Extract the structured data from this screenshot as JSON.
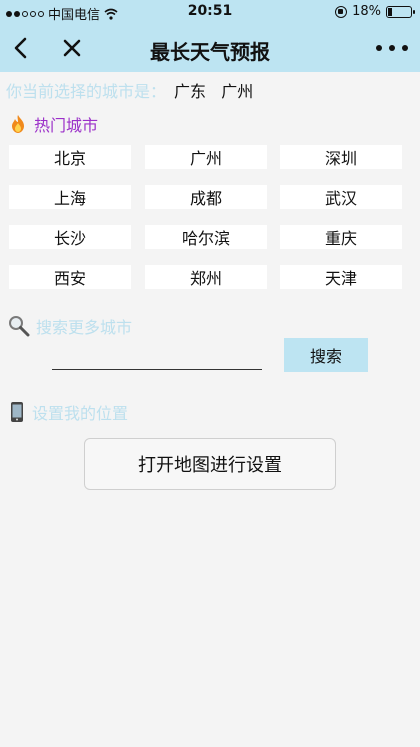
{
  "status_bar": {
    "carrier": "中国电信",
    "time": "20:51",
    "battery": "18%",
    "battery_level": 0.18
  },
  "nav": {
    "title": "最长天气预报"
  },
  "selection": {
    "label": "你当前选择的城市是：",
    "value": "广东   广州"
  },
  "hot_cities": {
    "title": "热门城市",
    "items": [
      "北京",
      "广州",
      "深圳",
      "上海",
      "成都",
      "武汉",
      "长沙",
      "哈尔滨",
      "重庆",
      "西安",
      "郑州",
      "天津"
    ]
  },
  "search": {
    "title": "搜索更多城市",
    "input_value": "",
    "button_label": "搜索"
  },
  "location": {
    "title": "设置我的位置",
    "button_label": "打开地图进行设置"
  },
  "colors": {
    "header_bg": "#bde4f2",
    "section_light": "#bde0ee",
    "hot_title": "#9b30c9"
  },
  "icons": {
    "hot": "fire-icon",
    "search": "magnifier-icon",
    "location": "phone-icon"
  }
}
